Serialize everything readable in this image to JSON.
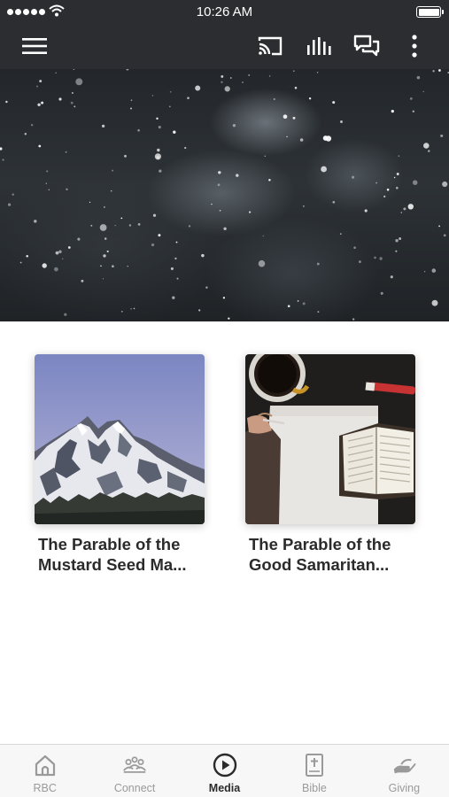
{
  "status_bar": {
    "time": "10:26 AM"
  },
  "app_bar": {
    "icons": [
      "menu-icon",
      "cast-icon",
      "audio-bars-icon",
      "chat-icon",
      "more-vertical-icon"
    ]
  },
  "hero": {
    "image": "snowfall-night-sky"
  },
  "media_items": [
    {
      "title_line1": "The Parable of the",
      "title_line2": "Mustard Seed Ma...",
      "image": "snowy-mountain"
    },
    {
      "title_line1": "The Parable of the",
      "title_line2": "Good Samaritan...",
      "image": "open-bible-coffee-desk"
    }
  ],
  "tabs": [
    {
      "label": "RBC",
      "icon": "church-icon",
      "active": false
    },
    {
      "label": "Connect",
      "icon": "people-icon",
      "active": false
    },
    {
      "label": "Media",
      "icon": "play-circle-icon",
      "active": true
    },
    {
      "label": "Bible",
      "icon": "bible-icon",
      "active": false
    },
    {
      "label": "Giving",
      "icon": "giving-hand-icon",
      "active": false
    }
  ],
  "colors": {
    "bar_background": "#2b2d30",
    "active_tab": "#2b2b2b",
    "inactive_tab": "#9a9a9a"
  }
}
